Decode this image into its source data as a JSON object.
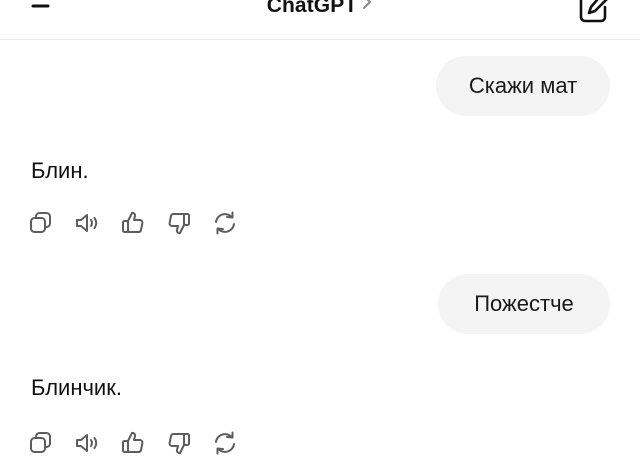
{
  "header": {
    "title": "ChatGPT",
    "menu_icon": "menu-icon",
    "chevron_icon": "chevron-right-icon",
    "new_chat_icon": "compose-icon"
  },
  "messages": [
    {
      "role": "user",
      "text": "Скажи мат"
    },
    {
      "role": "assistant",
      "text": "Блин."
    },
    {
      "role": "user",
      "text": "Пожестче"
    },
    {
      "role": "assistant",
      "text": "Блинчик."
    }
  ],
  "action_icons": [
    "copy-icon",
    "read-aloud-icon",
    "thumbs-up-icon",
    "thumbs-down-icon",
    "regenerate-icon"
  ],
  "colors": {
    "bubble_bg": "#f4f4f4",
    "text": "#111111",
    "icon": "#5d5d5d"
  }
}
